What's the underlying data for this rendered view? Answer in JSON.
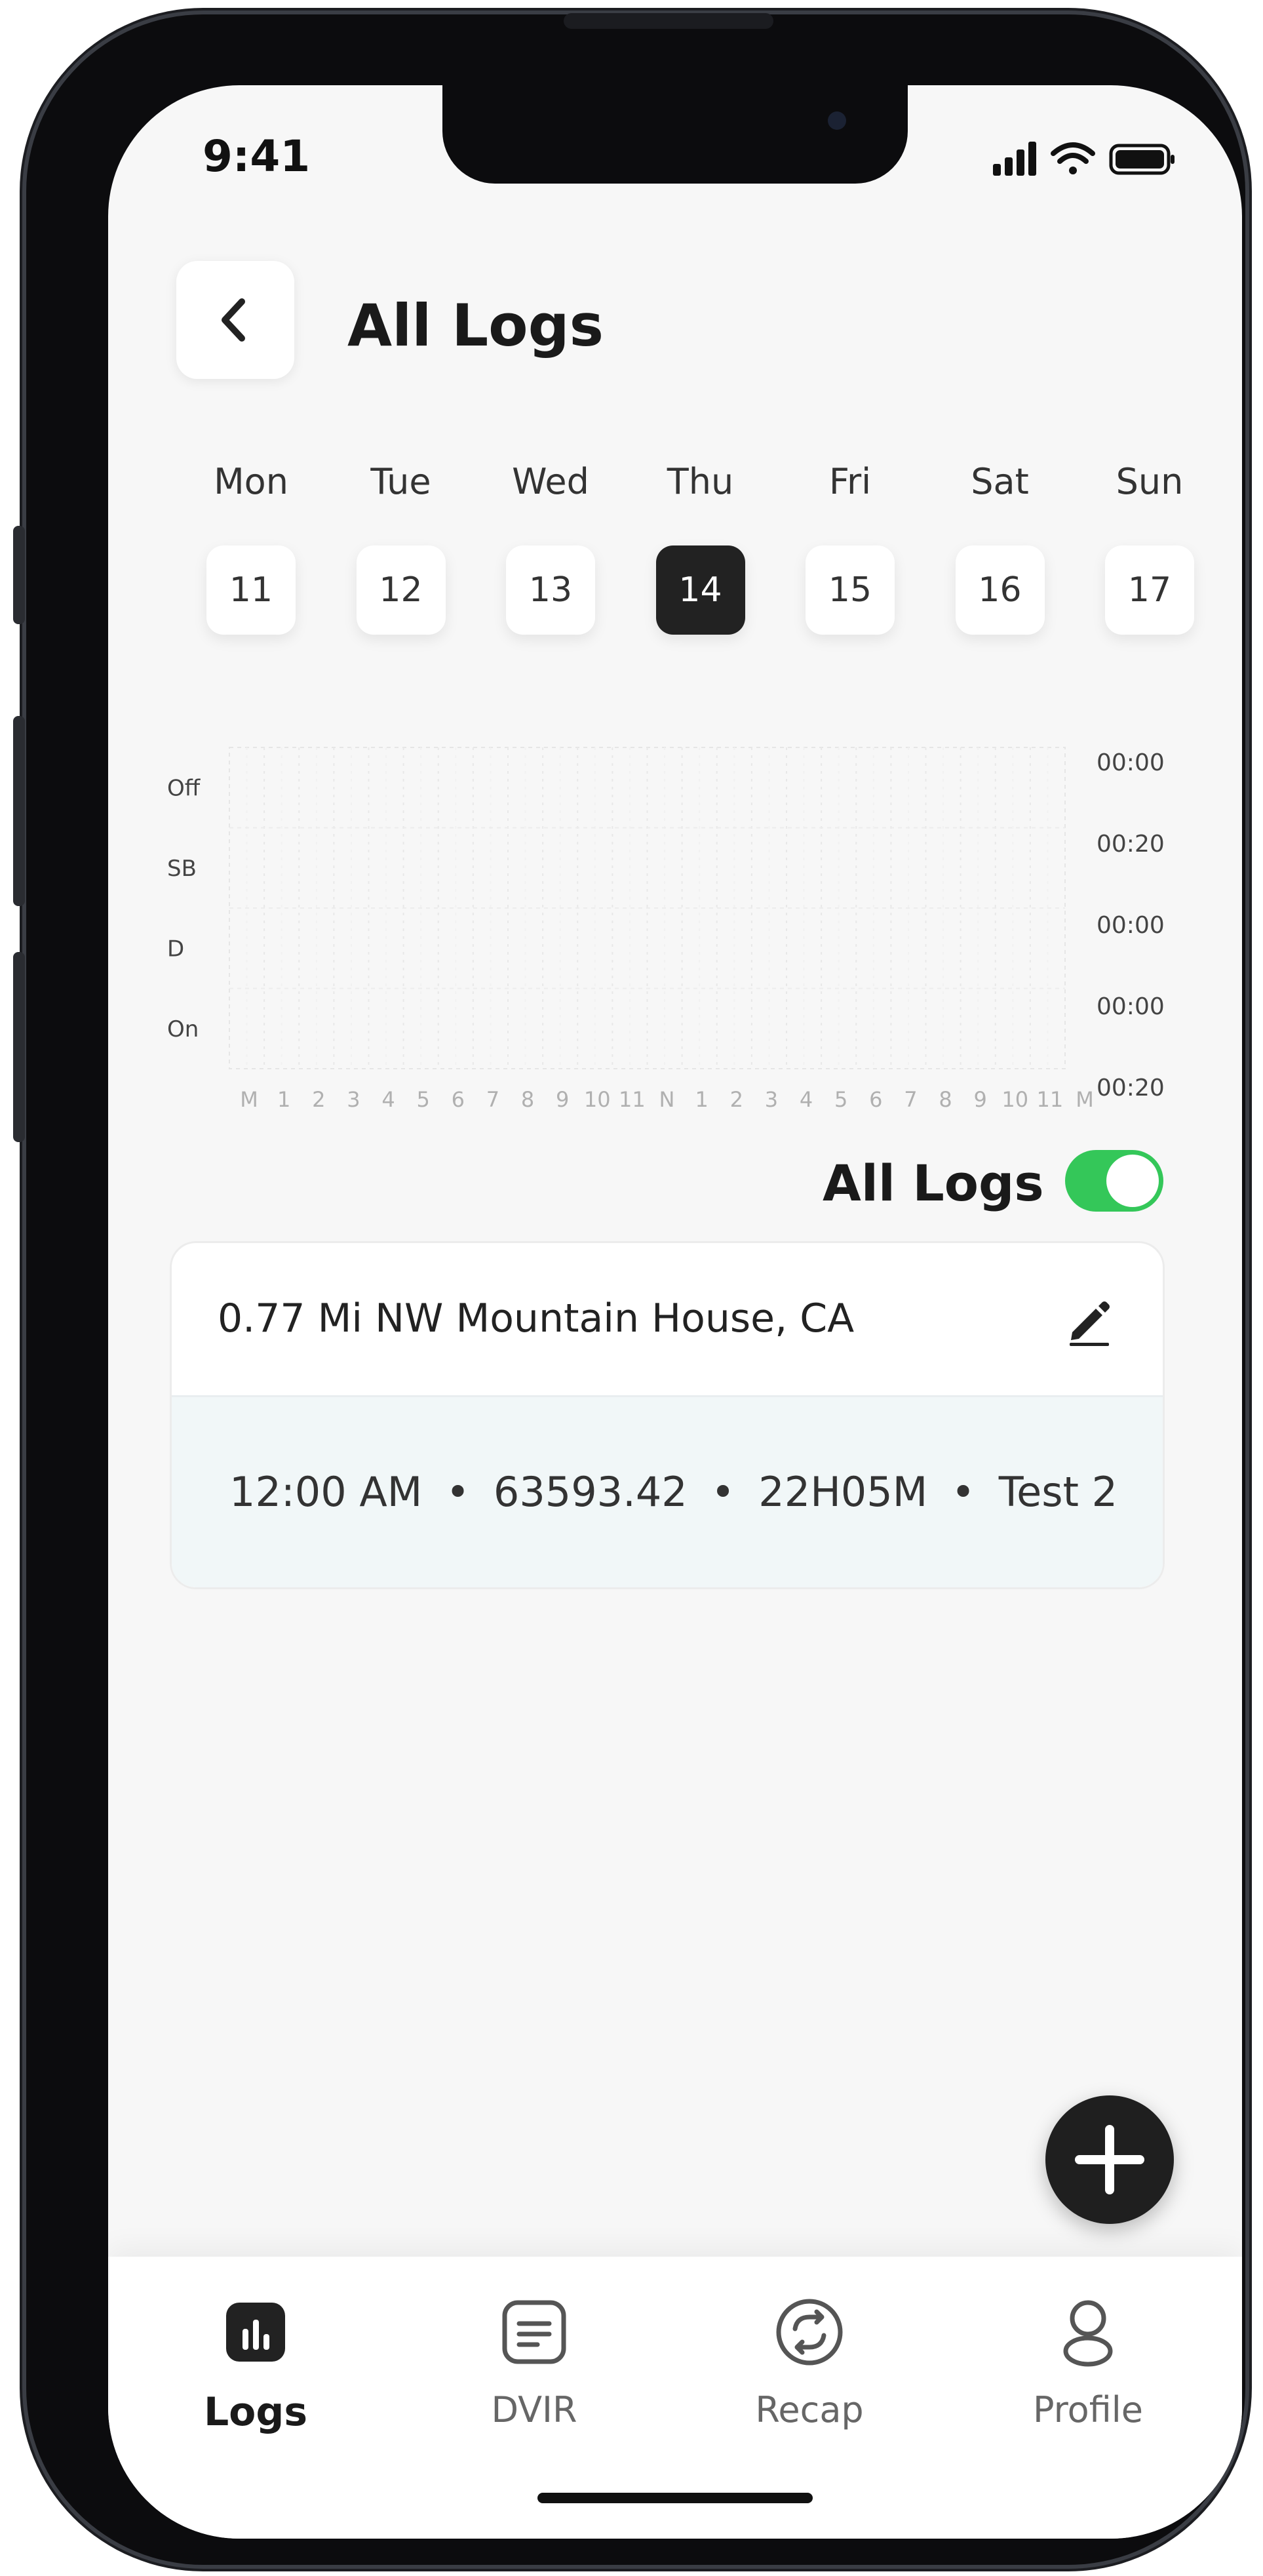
{
  "status_bar": {
    "time": "9:41"
  },
  "header": {
    "title": "All Logs"
  },
  "week": [
    {
      "day": "Mon",
      "date": "11",
      "active": false
    },
    {
      "day": "Tue",
      "date": "12",
      "active": false
    },
    {
      "day": "Wed",
      "date": "13",
      "active": false
    },
    {
      "day": "Thu",
      "date": "14",
      "active": true
    },
    {
      "day": "Fri",
      "date": "15",
      "active": false
    },
    {
      "day": "Sat",
      "date": "16",
      "active": false
    },
    {
      "day": "Sun",
      "date": "17",
      "active": false
    }
  ],
  "log_chart": {
    "status_labels": [
      "Off",
      "SB",
      "D",
      "On"
    ],
    "hour_labels": [
      "M",
      "1",
      "2",
      "3",
      "4",
      "5",
      "6",
      "7",
      "8",
      "9",
      "10",
      "11",
      "N",
      "1",
      "2",
      "3",
      "4",
      "5",
      "6",
      "7",
      "8",
      "9",
      "10",
      "11",
      "M"
    ],
    "totals": [
      "00:00",
      "00:20",
      "00:00",
      "00:00",
      "00:20"
    ]
  },
  "filter": {
    "label": "All Logs",
    "enabled": true
  },
  "log_entries": [
    {
      "location": "0.77 Mi NW Mountain House, CA",
      "time": "12:00 AM",
      "odometer": "63593.42",
      "duration": "22H05M",
      "note": "Test 2",
      "separator": "•"
    }
  ],
  "tabbar": {
    "items": [
      {
        "label": "Logs",
        "icon": "chart-icon",
        "active": true
      },
      {
        "label": "DVIR",
        "icon": "document-icon",
        "active": false
      },
      {
        "label": "Recap",
        "icon": "refresh-icon",
        "active": false
      },
      {
        "label": "Profile",
        "icon": "person-icon",
        "active": false
      }
    ]
  },
  "colors": {
    "accent_green": "#34c759",
    "dark": "#1f1f1f",
    "detail_bg": "#f1f7f8"
  }
}
